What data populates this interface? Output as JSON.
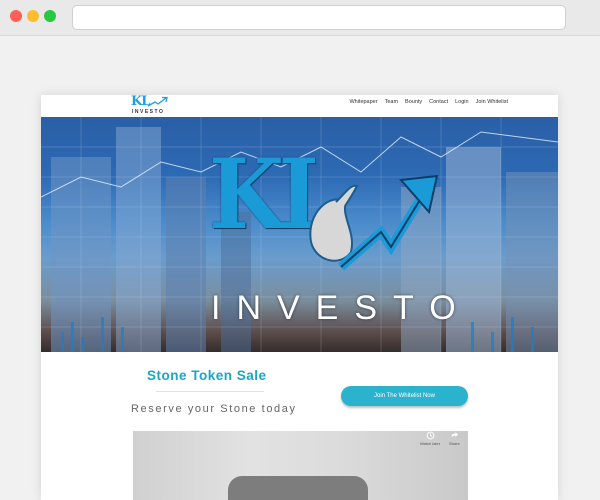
{
  "window": {
    "controls": [
      "close",
      "minimize",
      "maximize"
    ],
    "address": ""
  },
  "brand": {
    "logo_main": "KL",
    "logo_sub": "INVESTO"
  },
  "nav": {
    "items": [
      "Whitepaper",
      "Team",
      "Bounty",
      "Contact",
      "Login",
      "Join Whitelist"
    ]
  },
  "hero": {
    "title": "KL",
    "subtitle": "INVESTO"
  },
  "sale": {
    "title": "Stone Token Sale",
    "tagline": "Reserve your Stone today",
    "cta_label": "Join The Whitelist Now"
  },
  "video": {
    "watch_later_label": "Watch later",
    "share_label": "Share"
  },
  "colors": {
    "accent": "#1aa5c6",
    "button": "#2bb2cc",
    "brand_blue": "#1b9ad8"
  }
}
